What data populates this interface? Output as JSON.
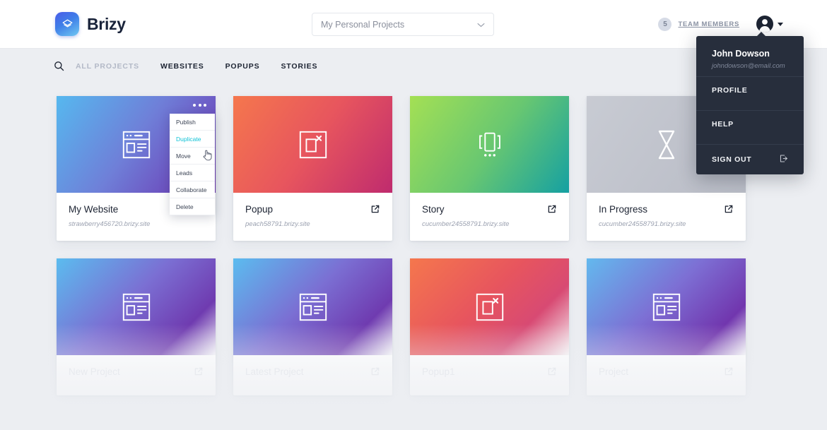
{
  "header": {
    "brand_name": "Brizy",
    "brand_logo_icon": "brizy-layers-logo",
    "project_select": {
      "value": "My Personal Projects",
      "icon": "chevron-down-icon"
    },
    "team": {
      "count": "5",
      "label": "TEAM MEMBERS"
    },
    "avatar_icon": "user-avatar-icon",
    "caret_icon": "caret-down-icon"
  },
  "user_menu": {
    "name": "John Dowson",
    "email": "johndowson@email.com",
    "items": [
      {
        "label": "PROFILE",
        "icon": ""
      },
      {
        "label": "HELP",
        "icon": ""
      },
      {
        "label": "SIGN OUT",
        "icon": "sign-out-icon"
      }
    ]
  },
  "subnav": {
    "search_icon": "search-icon",
    "items": [
      {
        "label": "ALL PROJECTS",
        "active": true
      },
      {
        "label": "WEBSITES",
        "active": false
      },
      {
        "label": "POPUPS",
        "active": false
      },
      {
        "label": "STORIES",
        "active": false
      }
    ]
  },
  "context_menu": {
    "items": [
      "Publish",
      "Duplicate",
      "Move",
      "Leads",
      "Collaborate",
      "Delete"
    ],
    "highlighted": "Duplicate",
    "highlight_color": "#10c2d6",
    "trigger_icon": "ellipsis-icon",
    "cursor_icon": "pointer-hand-cursor"
  },
  "cards": [
    {
      "title": "My Website",
      "url": "strawberry456720.brizy.site",
      "thumb_icon": "website-wireframe-icon",
      "gradient": "g-blueviolet",
      "ext_icon": "external-link-icon",
      "faded": false,
      "has_menu": true
    },
    {
      "title": "Popup",
      "url": "peach58791.brizy.site",
      "thumb_icon": "popup-close-icon",
      "gradient": "g-orangered",
      "ext_icon": "external-link-icon",
      "faded": false,
      "has_menu": false
    },
    {
      "title": "Story",
      "url": "cucumber24558791.brizy.site",
      "thumb_icon": "story-carousel-icon",
      "gradient": "g-greenteal",
      "ext_icon": "external-link-icon",
      "faded": false,
      "has_menu": false
    },
    {
      "title": "In Progress",
      "url": "cucumber24558791.brizy.site",
      "thumb_icon": "hourglass-icon",
      "gradient": "g-gray",
      "ext_icon": "external-link-icon",
      "faded": false,
      "has_menu": false
    },
    {
      "title": "New Project",
      "url": "",
      "thumb_icon": "website-wireframe-icon",
      "gradient": "g-bluepurple-fade",
      "ext_icon": "external-link-icon",
      "faded": true,
      "has_menu": false
    },
    {
      "title": "Latest Project",
      "url": "",
      "thumb_icon": "website-wireframe-icon",
      "gradient": "g-bluepurple-fade",
      "ext_icon": "external-link-icon",
      "faded": true,
      "has_menu": false
    },
    {
      "title": "Popup1",
      "url": "",
      "thumb_icon": "popup-close-icon",
      "gradient": "g-orangered-fade",
      "ext_icon": "external-link-icon",
      "faded": true,
      "has_menu": false
    },
    {
      "title": "Project",
      "url": "",
      "thumb_icon": "website-wireframe-icon",
      "gradient": "g-bluepurple-fade2",
      "ext_icon": "external-link-icon",
      "faded": true,
      "has_menu": false
    }
  ],
  "colors": {
    "page_bg": "#eceef2",
    "accent_teal": "#10c2d6",
    "dark_menu": "#272e3c",
    "text_dark": "#1d2433"
  }
}
